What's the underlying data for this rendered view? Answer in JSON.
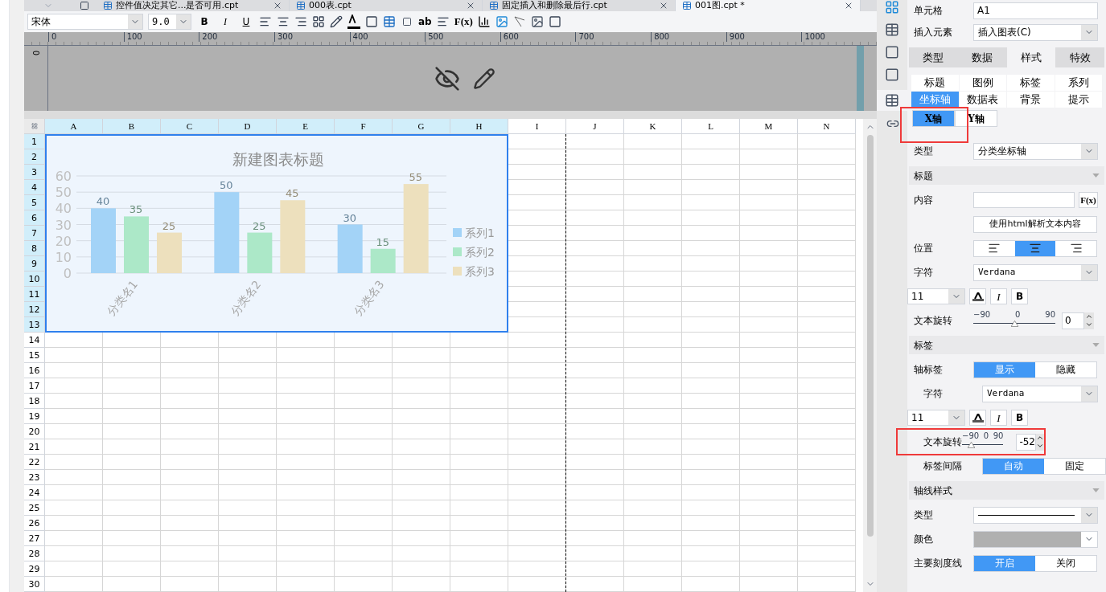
{
  "file_tabs": [
    {
      "label": "控件值决定其它...是否可用.cpt",
      "selected": false
    },
    {
      "label": "000表.cpt",
      "selected": false
    },
    {
      "label": "固定插入和删除最后行.cpt",
      "selected": false
    },
    {
      "label": "001图.cpt *",
      "selected": true
    }
  ],
  "toolbar": {
    "font": "宋体",
    "size": "9.0",
    "bold": "B",
    "italic": "I",
    "underline": "U",
    "text_button": "ab",
    "formula": "F(x)"
  },
  "ruler": {
    "labels": [
      "0",
      "100",
      "200",
      "300",
      "400",
      "500",
      "600",
      "700",
      "800",
      "900",
      "1000"
    ],
    "vertical_label": "0"
  },
  "sheet": {
    "columns": [
      {
        "label": "A",
        "selected": true
      },
      {
        "label": "B",
        "selected": true
      },
      {
        "label": "C",
        "selected": true
      },
      {
        "label": "D",
        "selected": true
      },
      {
        "label": "E",
        "selected": true
      },
      {
        "label": "F",
        "selected": true
      },
      {
        "label": "G",
        "selected": true
      },
      {
        "label": "H",
        "selected": true
      },
      {
        "label": "I",
        "selected": false
      },
      {
        "label": "J",
        "selected": false
      },
      {
        "label": "K",
        "selected": false
      },
      {
        "label": "L",
        "selected": false
      },
      {
        "label": "M",
        "selected": false
      },
      {
        "label": "N",
        "selected": false
      }
    ],
    "rows": [
      {
        "label": "1",
        "selected": true
      },
      {
        "label": "2",
        "selected": true
      },
      {
        "label": "3",
        "selected": true
      },
      {
        "label": "4",
        "selected": true
      },
      {
        "label": "5",
        "selected": true
      },
      {
        "label": "6",
        "selected": true
      },
      {
        "label": "7",
        "selected": true
      },
      {
        "label": "8",
        "selected": true
      },
      {
        "label": "9",
        "selected": true
      },
      {
        "label": "10",
        "selected": true
      },
      {
        "label": "11",
        "selected": true
      },
      {
        "label": "12",
        "selected": true
      },
      {
        "label": "13",
        "selected": true
      },
      {
        "label": "14",
        "selected": false
      },
      {
        "label": "15",
        "selected": false
      },
      {
        "label": "16",
        "selected": false
      },
      {
        "label": "17",
        "selected": false
      },
      {
        "label": "18",
        "selected": false
      },
      {
        "label": "19",
        "selected": false
      },
      {
        "label": "20",
        "selected": false
      },
      {
        "label": "21",
        "selected": false
      },
      {
        "label": "22",
        "selected": false
      },
      {
        "label": "23",
        "selected": false
      },
      {
        "label": "24",
        "selected": false
      },
      {
        "label": "25",
        "selected": false
      },
      {
        "label": "26",
        "selected": false
      },
      {
        "label": "27",
        "selected": false
      },
      {
        "label": "28",
        "selected": false
      },
      {
        "label": "29",
        "selected": false
      },
      {
        "label": "30",
        "selected": false
      }
    ]
  },
  "chart": {
    "chart_data": {
      "type": "bar",
      "title": "新建图表标题",
      "categories": [
        "分类名1",
        "分类名2",
        "分类名3"
      ],
      "series": [
        {
          "name": "系列1",
          "color": "#a3d3f7",
          "values": [
            40,
            50,
            30
          ]
        },
        {
          "name": "系列2",
          "color": "#ace8c8",
          "values": [
            35,
            25,
            15
          ]
        },
        {
          "name": "系列3",
          "color": "#ede0bd",
          "values": [
            25,
            45,
            55
          ]
        }
      ],
      "ylim": [
        0,
        60
      ],
      "yticks": [
        0,
        10,
        20,
        30,
        40,
        50,
        60
      ],
      "data_labels": true,
      "grid": true,
      "legend": "right"
    }
  },
  "panel": {
    "cell": {
      "label": "单元格",
      "value": "A1"
    },
    "insert": {
      "label": "插入元素",
      "value": "插入图表(C)"
    },
    "main_tabs": [
      {
        "label": "类型",
        "selected": false
      },
      {
        "label": "数据",
        "selected": false
      },
      {
        "label": "样式",
        "selected": true
      },
      {
        "label": "特效",
        "selected": false
      }
    ],
    "sub_tabs": [
      {
        "label": "标题",
        "selected": false
      },
      {
        "label": "图例",
        "selected": false
      },
      {
        "label": "标签",
        "selected": false
      },
      {
        "label": "系列",
        "selected": false
      },
      {
        "label": "坐标轴",
        "selected": true
      },
      {
        "label": "数据表",
        "selected": false
      },
      {
        "label": "背景",
        "selected": false
      },
      {
        "label": "提示",
        "selected": false
      }
    ],
    "axis_tabs": {
      "highlighted": true,
      "tabs": [
        {
          "label": "X轴",
          "selected": true
        },
        {
          "label": "Y轴",
          "selected": false
        }
      ]
    },
    "rows": [
      {
        "kind": "select",
        "label": "类型",
        "value": "分类坐标轴",
        "indented": false
      },
      {
        "kind": "section",
        "label": "标题"
      },
      {
        "kind": "input_fx",
        "label": "内容",
        "button": "F(x)"
      },
      {
        "kind": "button",
        "label": "使用html解析文本内容"
      },
      {
        "kind": "align",
        "label": "位置",
        "options": [
          {
            "selected": false
          },
          {
            "selected": true
          },
          {
            "selected": false
          }
        ]
      },
      {
        "kind": "select",
        "label": "字符",
        "value": "Verdana",
        "indented": false
      },
      {
        "kind": "font_style",
        "size": "11",
        "italic": "I",
        "bold": "B"
      },
      {
        "kind": "slider",
        "label": "文本旋转",
        "ticks": [
          "−90",
          "0",
          "90"
        ],
        "level": 0.5,
        "value": "0",
        "indented": false,
        "highlighted": false
      },
      {
        "kind": "section",
        "label": "标签"
      },
      {
        "kind": "segmented",
        "label": "轴标签",
        "indented": false,
        "options": [
          {
            "label": "显示",
            "selected": true
          },
          {
            "label": "隐藏",
            "selected": false
          }
        ]
      },
      {
        "kind": "select",
        "label": "字符",
        "value": "Verdana",
        "indented": true
      },
      {
        "kind": "font_style",
        "size": "11",
        "italic": "I",
        "bold": "B"
      },
      {
        "kind": "slider",
        "label": "文本旋转",
        "ticks": [
          "−90",
          "0",
          "90"
        ],
        "level": 0.21,
        "value": "-52",
        "indented": true,
        "highlighted": true
      },
      {
        "kind": "segmented",
        "label": "标签间隔",
        "indented": true,
        "options": [
          {
            "label": "自动",
            "selected": true
          },
          {
            "label": "固定",
            "selected": false
          }
        ]
      },
      {
        "kind": "section",
        "label": "轴线样式"
      },
      {
        "kind": "line_select",
        "label": "类型"
      },
      {
        "kind": "color_select",
        "label": "颜色"
      },
      {
        "kind": "segmented",
        "label": "主要刻度线",
        "indented": false,
        "options": [
          {
            "label": "开启",
            "selected": true
          },
          {
            "label": "关闭",
            "selected": false
          }
        ]
      }
    ]
  }
}
